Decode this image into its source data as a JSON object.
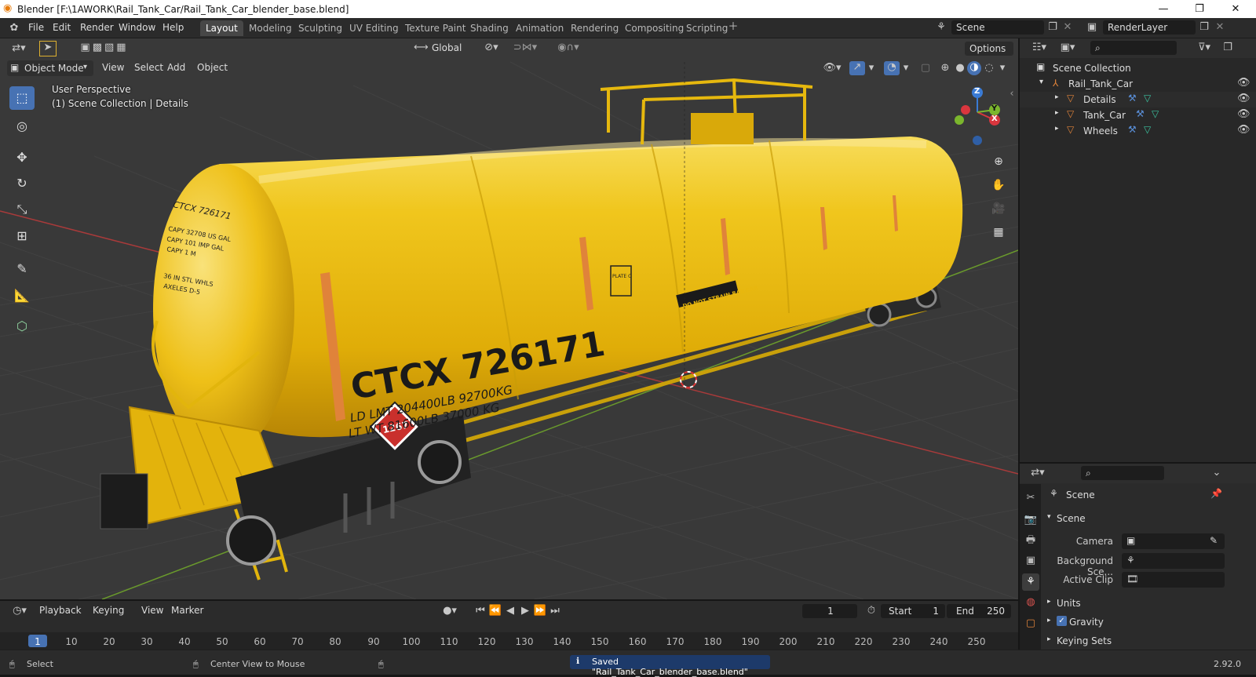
{
  "window": {
    "title": "Blender [F:\\1AWORK\\Rail_Tank_Car/Rail_Tank_Car_blender_base.blend]"
  },
  "menus": [
    "File",
    "Edit",
    "Render",
    "Window",
    "Help"
  ],
  "workspace_tabs": [
    "Layout",
    "Modeling",
    "Sculpting",
    "UV Editing",
    "Texture Paint",
    "Shading",
    "Animation",
    "Rendering",
    "Compositing",
    "Scripting"
  ],
  "scene_field": "Scene",
  "renderlayer_field": "RenderLayer",
  "toolbar": {
    "orientation": "Global",
    "options": "Options"
  },
  "viewport": {
    "mode": "Object Mode",
    "menus": [
      "View",
      "Select",
      "Add",
      "Object"
    ],
    "overlay_line1": "User Perspective",
    "overlay_line2": "(1) Scene Collection | Details",
    "gizmo": {
      "z": "Z",
      "y": "Y",
      "x": "X"
    }
  },
  "model": {
    "reporting_mark": "CTCX 726171",
    "ld_lmt": "LD LMT  204400LB 92700KG",
    "lt_wt": "LT WT    81600LB 37000 KG",
    "placard": "1267",
    "plate": "PLATE C",
    "end_mark": "CTCX 726171",
    "warning": "DO NOT STRAIN RAILCAR",
    "end_cap1": "CAPY 32708 US GAL",
    "end_cap2": "CAPY 101 IMP GAL",
    "end_cap3": "CAPY 1 M",
    "end_whls": "36 IN STL WHLS",
    "end_whls2": "AXELES D-5"
  },
  "outliner": {
    "root": "Scene Collection",
    "collection": "Rail_Tank_Car",
    "items": [
      "Details",
      "Tank_Car",
      "Wheels"
    ]
  },
  "properties": {
    "context": "Scene",
    "panel": "Scene",
    "camera_label": "Camera",
    "bg_label": "Background Sce...",
    "clip_label": "Active Clip",
    "units": "Units",
    "gravity": "Gravity",
    "keying": "Keying Sets"
  },
  "timeline": {
    "menus": [
      "Playback",
      "Keying",
      "View",
      "Marker"
    ],
    "current_frame": "1",
    "start_label": "Start",
    "start": "1",
    "end_label": "End",
    "end": "250",
    "ticks": [
      "1",
      "10",
      "20",
      "30",
      "40",
      "50",
      "60",
      "70",
      "80",
      "90",
      "100",
      "110",
      "120",
      "130",
      "140",
      "150",
      "160",
      "170",
      "180",
      "190",
      "200",
      "210",
      "220",
      "230",
      "240",
      "250"
    ]
  },
  "status": {
    "left": "Select",
    "middle": "Center View to Mouse",
    "message": "Saved \"Rail_Tank_Car_blender_base.blend\"",
    "version": "2.92.0"
  },
  "colors": {
    "accent": "#4772b3",
    "tank": "#e8b70e",
    "outline_orange": "#e0833a",
    "grid_bg": "#393939"
  }
}
